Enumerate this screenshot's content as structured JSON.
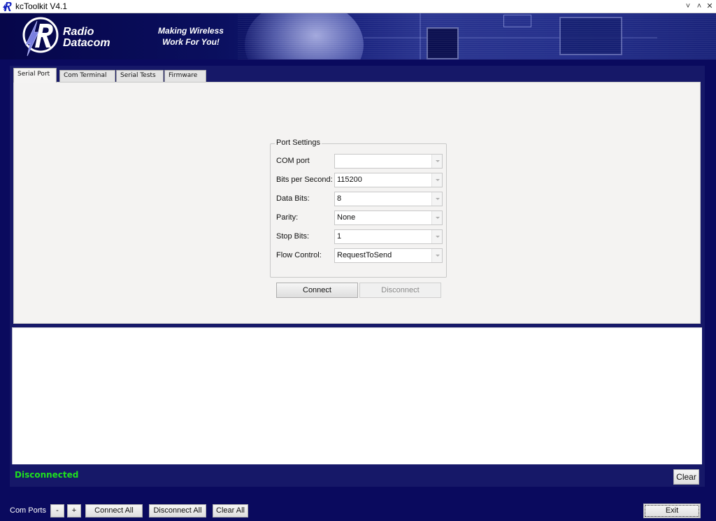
{
  "window": {
    "title": "kcToolkit V4.1",
    "controls": {
      "minimize": "˅",
      "maximize": "˄",
      "close": "✕"
    }
  },
  "banner": {
    "brand_line1": "Radio",
    "brand_line2": "Datacom",
    "tagline_line1": "Making Wireless",
    "tagline_line2": "Work For You!"
  },
  "tabs": [
    {
      "label": "Serial Port",
      "active": true
    },
    {
      "label": "Com Terminal",
      "active": false
    },
    {
      "label": "Serial Tests",
      "active": false
    },
    {
      "label": "Firmware",
      "active": false
    }
  ],
  "port_settings": {
    "title": "Port Settings",
    "fields": [
      {
        "label": "COM port",
        "value": ""
      },
      {
        "label": "Bits per Second:",
        "value": "115200"
      },
      {
        "label": "Data Bits:",
        "value": "8"
      },
      {
        "label": "Parity:",
        "value": "None"
      },
      {
        "label": "Stop Bits:",
        "value": "1"
      },
      {
        "label": "Flow Control:",
        "value": "RequestToSend"
      }
    ],
    "connect_label": "Connect",
    "disconnect_label": "Disconnect"
  },
  "log": {
    "content": ""
  },
  "status": {
    "text": "Disconnected",
    "color": "#1ee01e"
  },
  "footer": {
    "clear_label": "Clear",
    "com_ports_label": "Com Ports",
    "minus_label": "-",
    "plus_label": "+",
    "connect_all_label": "Connect All",
    "disconnect_all_label": "Disconnect All",
    "clear_all_label": "Clear All",
    "exit_label": "Exit"
  }
}
